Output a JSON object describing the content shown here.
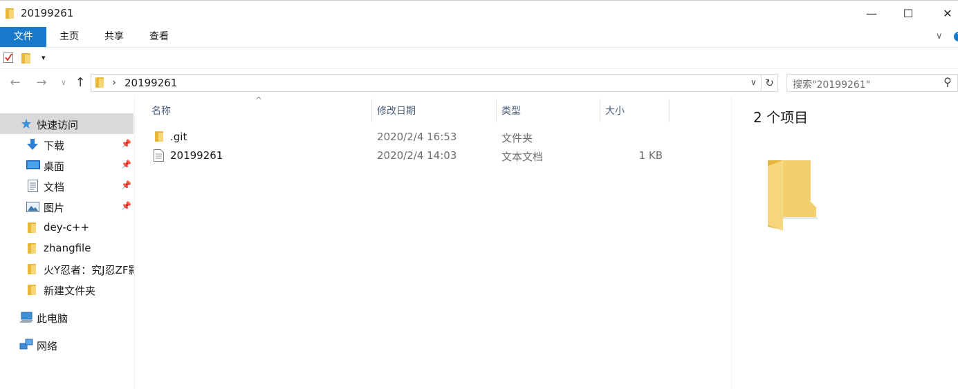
{
  "window": {
    "title": "20199261",
    "minimize_glyph": "—",
    "maximize_glyph": "☐",
    "close_glyph": "✕"
  },
  "ribbon": {
    "tabs": [
      {
        "label": "文件",
        "active": true
      },
      {
        "label": "主页"
      },
      {
        "label": "共享"
      },
      {
        "label": "查看"
      }
    ],
    "expand_glyph": "∨",
    "help_glyph": "?"
  },
  "quick_access_toolbar": {
    "dropdown_glyph": "▾"
  },
  "navigation": {
    "back_glyph": "←",
    "forward_glyph": "→",
    "recent_glyph": "∨",
    "up_glyph": "↑"
  },
  "address_bar": {
    "separator_glyph": "›",
    "path": "20199261",
    "dropdown_glyph": "∨",
    "refresh_glyph": "↻"
  },
  "search": {
    "placeholder": "搜索\"20199261\"",
    "icon_glyph": "⚲"
  },
  "sidebar": {
    "items": [
      {
        "label": "快速访问",
        "icon": "star-icon",
        "selected": true
      },
      {
        "label": "下载",
        "icon": "download-icon",
        "pinned": true
      },
      {
        "label": "桌面",
        "icon": "desktop-icon",
        "pinned": true
      },
      {
        "label": "文档",
        "icon": "document-icon",
        "pinned": true
      },
      {
        "label": "图片",
        "icon": "pictures-icon",
        "pinned": true
      },
      {
        "label": "dey-c++",
        "icon": "folder-icon"
      },
      {
        "label": "zhangfile",
        "icon": "folder-icon"
      },
      {
        "label": "火Y忍者：究J忍ZF影",
        "icon": "folder-icon"
      },
      {
        "label": "新建文件夹",
        "icon": "folder-icon"
      },
      {
        "label": "此电脑",
        "icon": "this-pc-icon"
      },
      {
        "label": "网络",
        "icon": "network-icon"
      }
    ],
    "pin_glyph": "📌"
  },
  "file_list": {
    "sort_glyph": "^",
    "columns": [
      {
        "label": "名称"
      },
      {
        "label": "修改日期"
      },
      {
        "label": "类型"
      },
      {
        "label": "大小"
      }
    ],
    "rows": [
      {
        "name": ".git",
        "modified": "2020/2/4 16:53",
        "type": "文件夹",
        "size": "",
        "icon": "folder-icon"
      },
      {
        "name": "20199261",
        "modified": "2020/2/4 14:03",
        "type": "文本文档",
        "size": "1 KB",
        "icon": "text-file-icon"
      }
    ]
  },
  "preview": {
    "item_count": "2 个项目"
  },
  "colors": {
    "accent": "#1979ca",
    "folder_back": "#e8b73a",
    "folder_front": "#f6d675",
    "selection": "#d9d9d9",
    "header_text": "#4c607a"
  }
}
